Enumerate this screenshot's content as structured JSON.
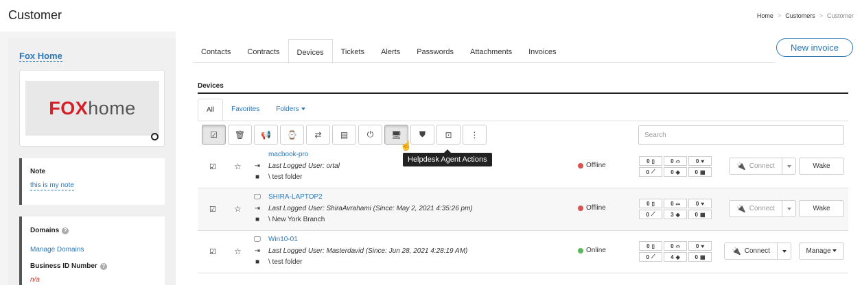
{
  "header": {
    "title": "Customer",
    "breadcrumb": [
      "Home",
      "Customers",
      "Customer"
    ]
  },
  "customer": {
    "name": "Fox Home",
    "logo_part1": "FOX",
    "logo_part2": "home",
    "note_label": "Note",
    "note_value": "this is my note",
    "domains_label": "Domains",
    "manage_domains": "Manage Domains",
    "business_id_label": "Business ID Number",
    "business_id_value": "n/a"
  },
  "tabs": [
    "Contacts",
    "Contracts",
    "Devices",
    "Tickets",
    "Alerts",
    "Passwords",
    "Attachments",
    "Invoices"
  ],
  "active_tab": "Devices",
  "new_invoice_label": "New invoice",
  "devices": {
    "title": "Devices",
    "subtabs": [
      "All",
      "Favorites",
      "Folders"
    ],
    "search_placeholder": "Search",
    "tooltip": "Helpdesk Agent Actions",
    "toolbar": [
      {
        "icon": "check-square-icon",
        "glyph": "☑"
      },
      {
        "icon": "trash-icon",
        "glyph": "🗑"
      },
      {
        "icon": "megaphone-icon",
        "glyph": "📢"
      },
      {
        "icon": "drive-clock-icon",
        "glyph": "⌚"
      },
      {
        "icon": "transfer-icon",
        "glyph": "⇄"
      },
      {
        "icon": "script-icon",
        "glyph": "▤"
      },
      {
        "icon": "power-icon",
        "glyph": "⏻"
      },
      {
        "icon": "monitor-icon",
        "glyph": "🖥"
      },
      {
        "icon": "shield-icon",
        "glyph": "⛊"
      },
      {
        "icon": "remote-desktop-icon",
        "glyph": "⊡"
      },
      {
        "icon": "more-vertical-icon",
        "glyph": "⋮"
      }
    ],
    "rows": [
      {
        "name": "macbook-pro",
        "os_icon": "apple-icon",
        "os_glyph": "",
        "login": "Last Logged User: ortal",
        "folder": "\\ test folder",
        "status": "Offline",
        "status_color": "#d9534f",
        "stats": [
          "0",
          "0",
          "0",
          "0",
          "0",
          "0"
        ],
        "connect": "Connect",
        "action": "Wake"
      },
      {
        "name": "SHIRA-LAPTOP2",
        "os_icon": "desktop-icon",
        "os_glyph": "🖵",
        "login": "Last Logged User: ShiraAvrahami (Since: May 2, 2021 4:35:26 pm)",
        "folder": "\\ New York Branch",
        "status": "Offline",
        "status_color": "#d9534f",
        "stats": [
          "0",
          "0",
          "0",
          "0",
          "3",
          "0"
        ],
        "connect": "Connect",
        "action": "Wake"
      },
      {
        "name": "Win10-01",
        "os_icon": "desktop-icon",
        "os_glyph": "🖵",
        "login": "Last Logged User: Masterdavid (Since: Jun 28, 2021 4:28:19 AM)",
        "folder": "\\ test folder",
        "status": "Online",
        "status_color": "#5cb85c",
        "stats": [
          "0",
          "0",
          "0",
          "0",
          "4",
          "0"
        ],
        "connect": "Connect",
        "action": "Manage"
      }
    ]
  }
}
